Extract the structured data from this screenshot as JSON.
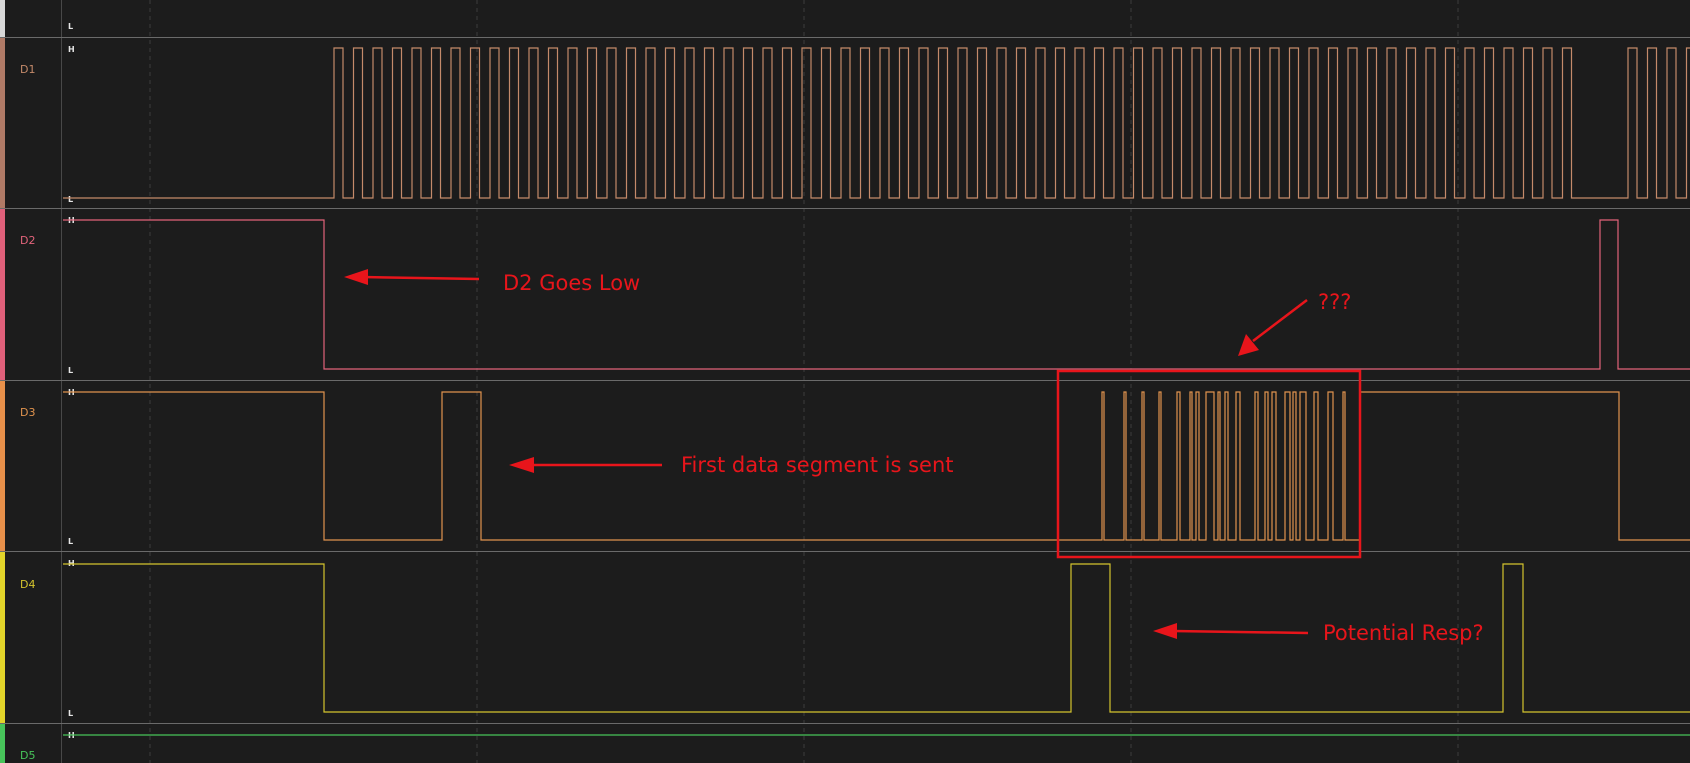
{
  "level_labels": {
    "high": "H",
    "low": "L"
  },
  "top_strip": {
    "low_label": "L"
  },
  "channels": [
    {
      "id": "d1",
      "name": "D1",
      "color": "#c48a6a",
      "stripe": "#b07a66"
    },
    {
      "id": "d2",
      "name": "D2",
      "color": "#e2637a",
      "stripe": "#e0607a"
    },
    {
      "id": "d3",
      "name": "D3",
      "color": "#e0934e",
      "stripe": "#e8904a"
    },
    {
      "id": "d4",
      "name": "D4",
      "color": "#d4c42e",
      "stripe": "#e2d42a"
    },
    {
      "id": "d5",
      "name": "D5",
      "color": "#47c45a",
      "stripe": "#47c45a"
    }
  ],
  "annotations": {
    "d2_low": "D2 Goes Low",
    "unknown": "???",
    "first_segment": "First data segment is sent",
    "potential_resp": "Potential Resp?"
  },
  "colors": {
    "background": "#1c1c1c",
    "annotation": "#e8151b",
    "grid": "#3c3c3c",
    "separator": "#6a6a6a"
  }
}
